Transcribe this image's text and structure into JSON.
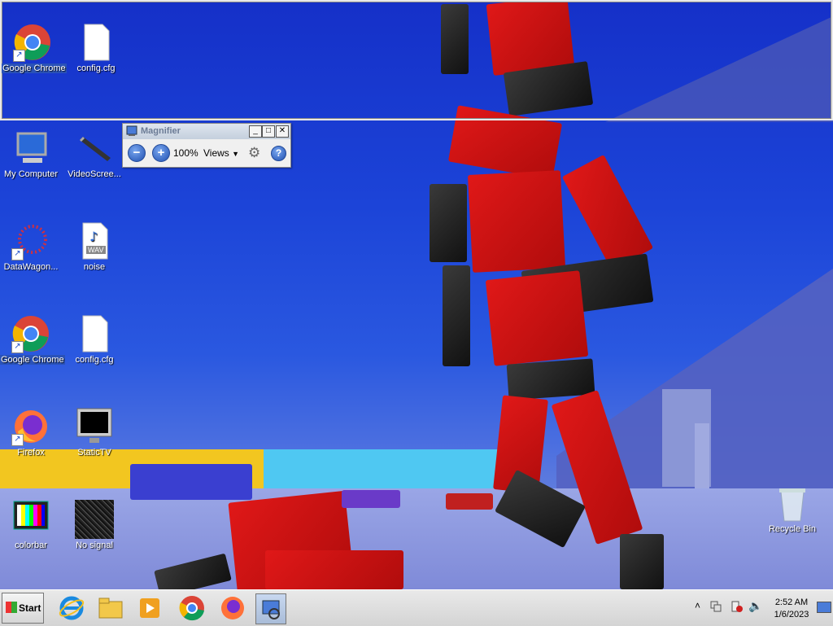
{
  "desktop": {
    "icons": [
      {
        "label": "Google Chrome",
        "glyph": "chrome-icon"
      },
      {
        "label": "config.cfg",
        "glyph": "file-icon"
      },
      {
        "label": "My Computer",
        "glyph": "computer-icon"
      },
      {
        "label": "VideoScree...",
        "glyph": "video-screen-icon"
      },
      {
        "label": "DataWagon...",
        "glyph": "datawagon-icon"
      },
      {
        "label": "noise",
        "glyph": "wav-file-icon",
        "badge": "WAV"
      },
      {
        "label": "Google Chrome",
        "glyph": "chrome-icon"
      },
      {
        "label": "config.cfg",
        "glyph": "file-icon"
      },
      {
        "label": "Firefox",
        "glyph": "firefox-icon"
      },
      {
        "label": "StaticTV",
        "glyph": "tv-icon"
      },
      {
        "label": "colorbar",
        "glyph": "colorbar-icon"
      },
      {
        "label": "No signal",
        "glyph": "noise-screen-icon"
      },
      {
        "label": "Recycle Bin",
        "glyph": "recycle-bin-icon"
      }
    ],
    "magnified": {
      "icons": [
        {
          "label": "Google Chrome",
          "glyph": "chrome-icon"
        },
        {
          "label": "config.cfg",
          "glyph": "file-icon"
        }
      ]
    }
  },
  "magnifier": {
    "title": "Magnifier",
    "zoom": "100%",
    "views_label": "Views",
    "buttons": {
      "zoom_out": "−",
      "zoom_in": "+",
      "minimize": "_",
      "maximize": "□",
      "close": "✕",
      "help": "?"
    }
  },
  "taskbar": {
    "start_label": "Start",
    "pinned": [
      {
        "name": "internet-explorer-icon"
      },
      {
        "name": "file-explorer-icon"
      },
      {
        "name": "media-player-icon"
      },
      {
        "name": "chrome-icon"
      },
      {
        "name": "firefox-icon"
      },
      {
        "name": "magnifier-icon",
        "active": true
      }
    ],
    "tray": {
      "time": "2:52 AM",
      "date": "1/6/2023",
      "expand": "˄"
    }
  },
  "colors": {
    "wall_blue": "#1c44d8",
    "block_red": "#d01414",
    "block_black": "#1e1e1e",
    "selection": "#2a52b8",
    "taskbar": "#dcdcdc"
  }
}
